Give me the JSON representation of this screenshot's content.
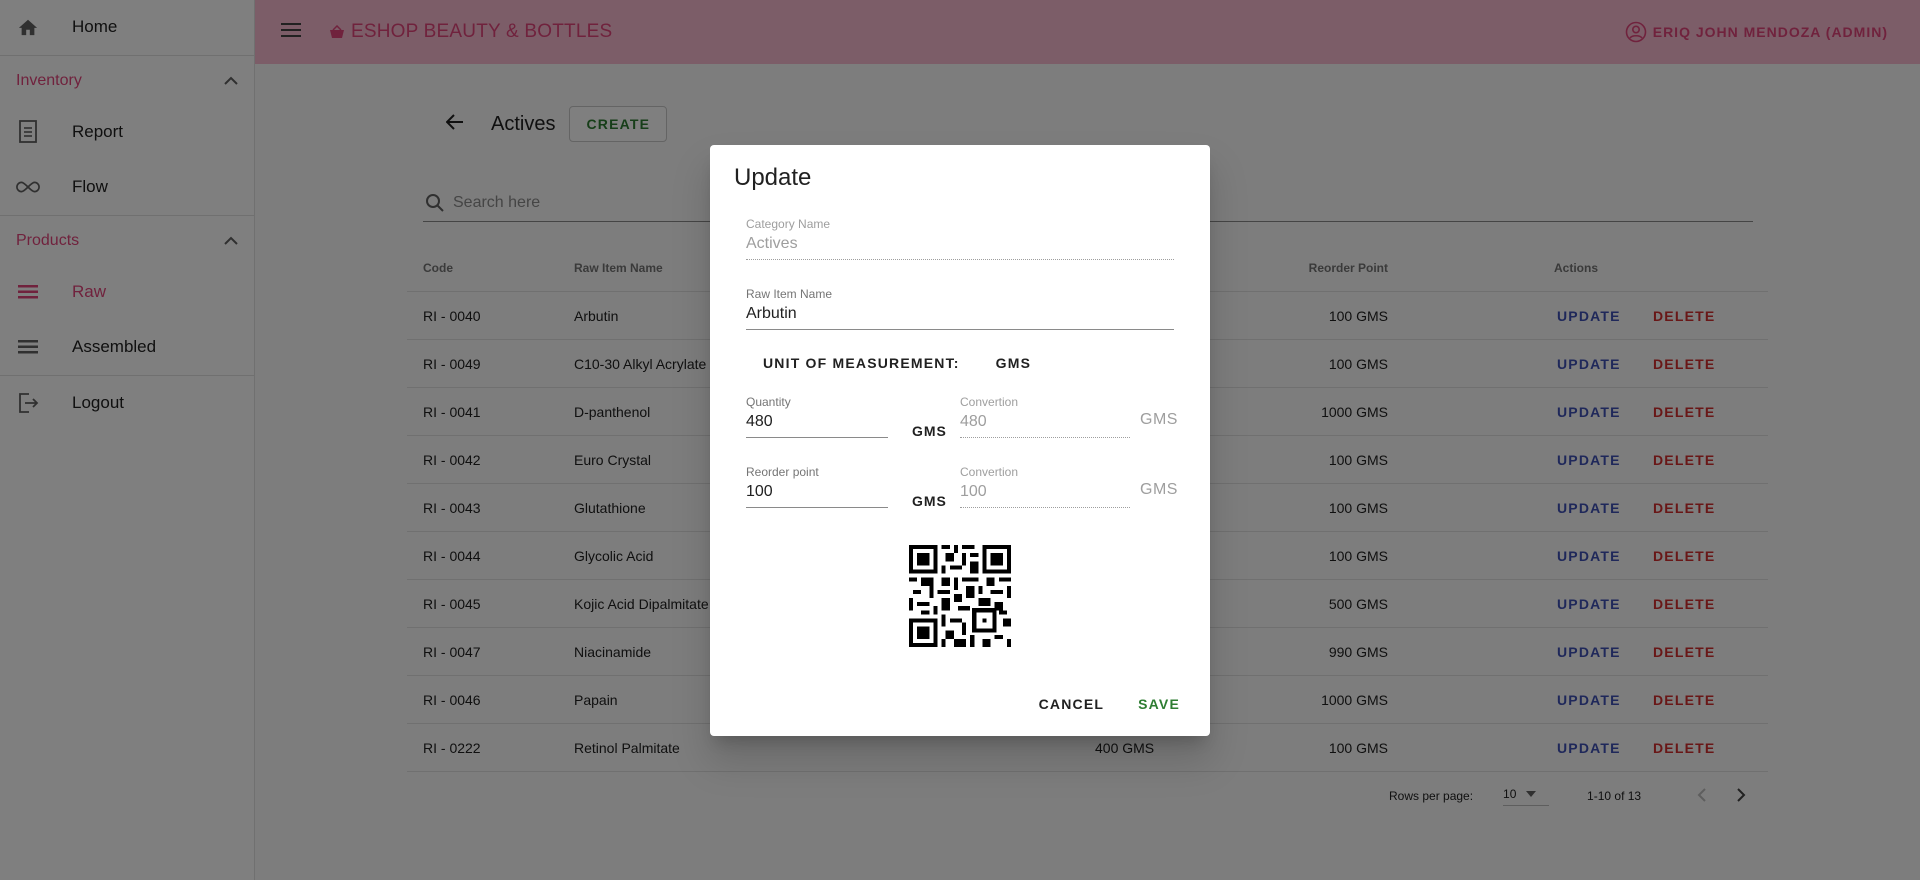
{
  "app": {
    "brand": "ESHOP BEAUTY & BOTTLES",
    "user": "ERIQ JOHN MENDOZA (ADMIN)"
  },
  "sidebar": {
    "home": "Home",
    "inventory": {
      "label": "Inventory",
      "items": [
        {
          "label": "Report",
          "icon": "report-icon"
        },
        {
          "label": "Flow",
          "icon": "infinity-icon"
        }
      ]
    },
    "products": {
      "label": "Products",
      "items": [
        {
          "label": "Raw",
          "icon": "list-icon",
          "active": true
        },
        {
          "label": "Assembled",
          "icon": "list-icon"
        }
      ]
    },
    "logout": "Logout"
  },
  "page": {
    "title": "Actives",
    "create_label": "CREATE",
    "search_placeholder": "Search here"
  },
  "table": {
    "headers": {
      "code": "Code",
      "name": "Raw Item Name",
      "reorder": "Reorder Point",
      "actions": "Actions"
    },
    "update_label": "UPDATE",
    "delete_label": "DELETE",
    "rows": [
      {
        "code": "RI - 0040",
        "name": "Arbutin",
        "qty": "",
        "reorder": "100 GMS"
      },
      {
        "code": "RI - 0049",
        "name": "C10-30 Alkyl Acrylate",
        "qty": "",
        "reorder": "100 GMS"
      },
      {
        "code": "RI - 0041",
        "name": "D-panthenol",
        "qty": "",
        "reorder": "1000 GMS"
      },
      {
        "code": "RI - 0042",
        "name": "Euro Crystal",
        "qty": "",
        "reorder": "100 GMS"
      },
      {
        "code": "RI - 0043",
        "name": "Glutathione",
        "qty": "",
        "reorder": "100 GMS"
      },
      {
        "code": "RI - 0044",
        "name": "Glycolic Acid",
        "qty": "",
        "reorder": "100 GMS"
      },
      {
        "code": "RI - 0045",
        "name": "Kojic Acid Dipalmitate",
        "qty": "",
        "reorder": "500 GMS"
      },
      {
        "code": "RI - 0047",
        "name": "Niacinamide",
        "qty": "",
        "reorder": "990 GMS"
      },
      {
        "code": "RI - 0046",
        "name": "Papain",
        "qty": "",
        "reorder": "1000 GMS"
      },
      {
        "code": "RI - 0222",
        "name": "Retinol Palmitate",
        "qty": "400 GMS",
        "reorder": "100 GMS"
      }
    ]
  },
  "pagination": {
    "rows_per_page_label": "Rows per page:",
    "rows_per_page": "10",
    "range": "1-10 of 13"
  },
  "dialog": {
    "title": "Update",
    "category_label": "Category Name",
    "category_value": "Actives",
    "raw_name_label": "Raw Item Name",
    "raw_name_value": "Arbutin",
    "uom_label": "UNIT OF MEASUREMENT:",
    "uom_value": "GMS",
    "quantity_label": "Quantity",
    "quantity_value": "480",
    "quantity_unit": "GMS",
    "qty_convertion_label": "Convertion",
    "qty_convertion_value": "480",
    "qty_convertion_unit": "GMS",
    "reorder_label": "Reorder point",
    "reorder_value": "100",
    "reorder_unit": "GMS",
    "reorder_convertion_label": "Convertion",
    "reorder_convertion_value": "100",
    "reorder_convertion_unit": "GMS",
    "cancel_label": "CANCEL",
    "save_label": "SAVE"
  },
  "colors": {
    "brand": "#e0457b",
    "topbar": "#f8bbd0",
    "update": "#3f51b5",
    "delete": "#d32f2f",
    "save": "#2e7d32"
  }
}
